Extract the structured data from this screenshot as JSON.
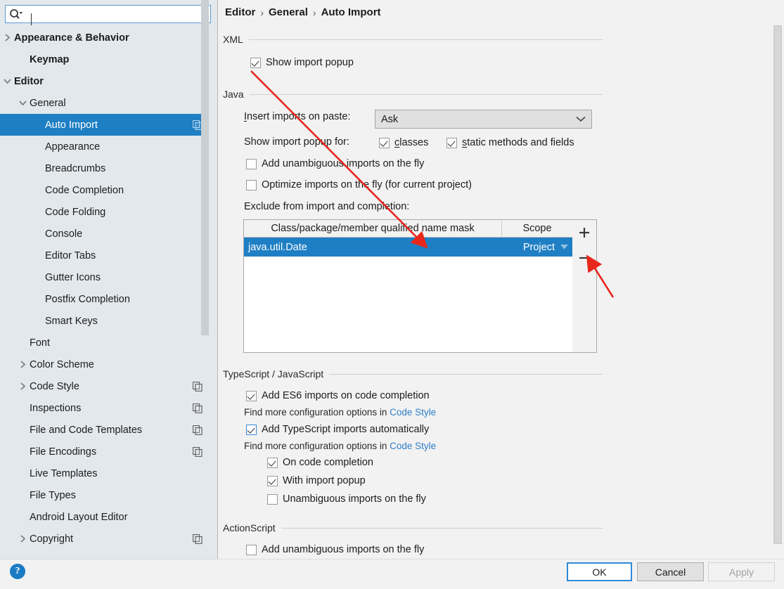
{
  "search": {
    "value": "",
    "placeholder": "",
    "icon": "search-icon"
  },
  "sidebar": {
    "items": [
      {
        "label": "Appearance & Behavior",
        "indent": 0,
        "twisty": "collapsed",
        "bold": true,
        "copy": false,
        "selected": false
      },
      {
        "label": "Keymap",
        "indent": 1,
        "twisty": "none",
        "bold": true,
        "copy": false,
        "selected": false
      },
      {
        "label": "Editor",
        "indent": 0,
        "twisty": "expanded",
        "bold": true,
        "copy": false,
        "selected": false
      },
      {
        "label": "General",
        "indent": 1,
        "twisty": "expanded",
        "bold": false,
        "copy": false,
        "selected": false
      },
      {
        "label": "Auto Import",
        "indent": 2,
        "twisty": "none",
        "bold": false,
        "copy": true,
        "selected": true
      },
      {
        "label": "Appearance",
        "indent": 2,
        "twisty": "none",
        "bold": false,
        "copy": false,
        "selected": false
      },
      {
        "label": "Breadcrumbs",
        "indent": 2,
        "twisty": "none",
        "bold": false,
        "copy": false,
        "selected": false
      },
      {
        "label": "Code Completion",
        "indent": 2,
        "twisty": "none",
        "bold": false,
        "copy": false,
        "selected": false
      },
      {
        "label": "Code Folding",
        "indent": 2,
        "twisty": "none",
        "bold": false,
        "copy": false,
        "selected": false
      },
      {
        "label": "Console",
        "indent": 2,
        "twisty": "none",
        "bold": false,
        "copy": false,
        "selected": false
      },
      {
        "label": "Editor Tabs",
        "indent": 2,
        "twisty": "none",
        "bold": false,
        "copy": false,
        "selected": false
      },
      {
        "label": "Gutter Icons",
        "indent": 2,
        "twisty": "none",
        "bold": false,
        "copy": false,
        "selected": false
      },
      {
        "label": "Postfix Completion",
        "indent": 2,
        "twisty": "none",
        "bold": false,
        "copy": false,
        "selected": false
      },
      {
        "label": "Smart Keys",
        "indent": 2,
        "twisty": "none",
        "bold": false,
        "copy": false,
        "selected": false
      },
      {
        "label": "Font",
        "indent": 1,
        "twisty": "none",
        "bold": false,
        "copy": false,
        "selected": false
      },
      {
        "label": "Color Scheme",
        "indent": 1,
        "twisty": "collapsed",
        "bold": false,
        "copy": false,
        "selected": false
      },
      {
        "label": "Code Style",
        "indent": 1,
        "twisty": "collapsed",
        "bold": false,
        "copy": true,
        "selected": false
      },
      {
        "label": "Inspections",
        "indent": 1,
        "twisty": "none",
        "bold": false,
        "copy": true,
        "selected": false
      },
      {
        "label": "File and Code Templates",
        "indent": 1,
        "twisty": "none",
        "bold": false,
        "copy": true,
        "selected": false
      },
      {
        "label": "File Encodings",
        "indent": 1,
        "twisty": "none",
        "bold": false,
        "copy": true,
        "selected": false
      },
      {
        "label": "Live Templates",
        "indent": 1,
        "twisty": "none",
        "bold": false,
        "copy": false,
        "selected": false
      },
      {
        "label": "File Types",
        "indent": 1,
        "twisty": "none",
        "bold": false,
        "copy": false,
        "selected": false
      },
      {
        "label": "Android Layout Editor",
        "indent": 1,
        "twisty": "none",
        "bold": false,
        "copy": false,
        "selected": false
      },
      {
        "label": "Copyright",
        "indent": 1,
        "twisty": "collapsed",
        "bold": false,
        "copy": true,
        "selected": false
      }
    ]
  },
  "breadcrumb": {
    "part1": "Editor",
    "part2": "General",
    "part3": "Auto Import",
    "separator": "›"
  },
  "xml": {
    "title": "XML",
    "show_import_popup": {
      "label": "Show import popup",
      "checked": true
    }
  },
  "java": {
    "title": "Java",
    "insert_imports_label": "Insert imports on paste:",
    "insert_imports_mnemonic": "I",
    "insert_imports_value": "Ask",
    "show_import_popup_for_label": "Show import popup for:",
    "classes": {
      "label": "classes",
      "mnemonic": "c",
      "checked": true
    },
    "static_methods": {
      "label": "static methods and fields",
      "mnemonic": "s",
      "checked": true
    },
    "add_unambiguous": {
      "label": "Add unambiguous imports on the fly",
      "checked": false
    },
    "optimize_imports": {
      "label": "Optimize imports on the fly (for current project)",
      "checked": false
    },
    "exclude_label": "Exclude from import and completion:",
    "table": {
      "columns": [
        "Class/package/member qualified name mask",
        "Scope"
      ],
      "rows": [
        {
          "mask": "java.util.Date",
          "scope": "Project",
          "selected": true
        }
      ],
      "add_button": "+",
      "remove_button": "−"
    }
  },
  "typescript": {
    "title": "TypeScript / JavaScript",
    "add_es6": {
      "label": "Add ES6 imports on code completion",
      "checked": true,
      "focused": false
    },
    "hint1_prefix": "Find more configuration options in ",
    "hint1_link": "Code Style",
    "add_ts_auto": {
      "label": "Add TypeScript imports automatically",
      "checked": true,
      "focused": true
    },
    "hint2_prefix": "Find more configuration options in ",
    "hint2_link": "Code Style",
    "on_code_completion": {
      "label": "On code completion",
      "checked": true
    },
    "with_import_popup": {
      "label": "With import popup",
      "checked": true
    },
    "unambiguous_on_fly": {
      "label": "Unambiguous imports on the fly",
      "checked": false
    }
  },
  "actionscript": {
    "title": "ActionScript",
    "add_unambiguous": {
      "label": "Add unambiguous imports on the fly",
      "checked": false
    }
  },
  "footer": {
    "help": "?",
    "ok": "OK",
    "cancel": "Cancel",
    "apply": "Apply"
  },
  "colors": {
    "selection_blue": "#1f7fc4",
    "link_blue": "#2f7ec8",
    "accent_focus": "#3a87d8",
    "annotation_red": "#e8271c",
    "sidebar_bg": "#e3e8ec",
    "panel_bg": "#f2f2f2"
  }
}
